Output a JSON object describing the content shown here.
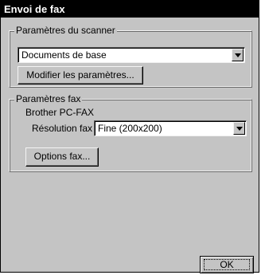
{
  "window": {
    "title": "Envoi de fax"
  },
  "scanner": {
    "legend": "Paramètres du scanner",
    "profile_value": "Documents de base",
    "modify_button": "Modifier les paramètres..."
  },
  "fax": {
    "legend": "Paramètres fax",
    "driver_name": "Brother PC-FAX",
    "resolution_label": "Résolution fax :",
    "resolution_value": "Fine (200x200)",
    "options_button": "Options fax..."
  },
  "footer": {
    "ok_button": "OK"
  }
}
